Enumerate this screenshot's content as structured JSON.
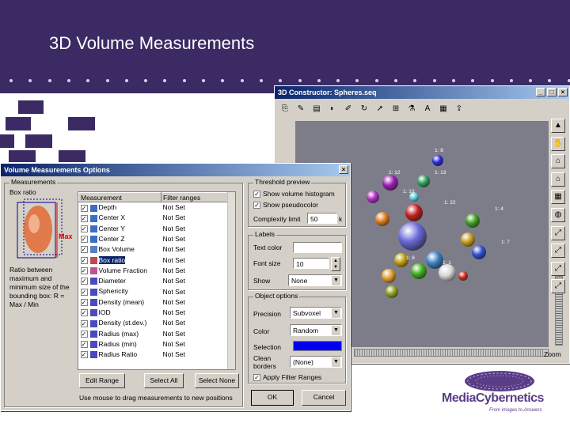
{
  "slide": {
    "title": "3D Volume Measurements"
  },
  "viewer": {
    "title": "3D Constructor: Spheres.seq",
    "zoom_label": "Zoom",
    "toolbar_icons": [
      "copy-icon",
      "wand-icon",
      "document-icon",
      "palette-icon",
      "brush-icon",
      "rotate-icon",
      "arrow-icon",
      "measure-icon",
      "flask-icon",
      "text-icon",
      "table-icon",
      "export-icon"
    ],
    "side_icons": [
      "pointer-icon",
      "hand-icon",
      "home-icon",
      "house-add-icon",
      "grid-icon",
      "sphere-icon",
      "vector-icon",
      "vector-icon",
      "vector-icon",
      "vector-icon"
    ],
    "sphere_labels": [
      "1: 8",
      "1: 12",
      "1: 13",
      "1: 10",
      "1: 22",
      "1: 4",
      "1: 7",
      "1: 6",
      "1: 1"
    ]
  },
  "dialog": {
    "title": "Volume Measurements Options",
    "measurements_group": "Measurements",
    "box_ratio_label": "Box ratio",
    "max_label": "Max",
    "description": "Ratio between maximum and minimum size of the bounding box: R = Max / Min",
    "columns": [
      "Measurement",
      "Filter ranges"
    ],
    "rows": [
      {
        "name": "Depth",
        "filter": "Not Set"
      },
      {
        "name": "Center X",
        "filter": "Not Set"
      },
      {
        "name": "Center Y",
        "filter": "Not Set"
      },
      {
        "name": "Center Z",
        "filter": "Not Set"
      },
      {
        "name": "Box Volume",
        "filter": "Not Set"
      },
      {
        "name": "Box ratio",
        "filter": "Not Set"
      },
      {
        "name": "Volume Fraction",
        "filter": "Not Set"
      },
      {
        "name": "Diameter",
        "filter": "Not Set"
      },
      {
        "name": "Sphericity",
        "filter": "Not Set"
      },
      {
        "name": "Density (mean)",
        "filter": "Not Set"
      },
      {
        "name": "IOD",
        "filter": "Not Set"
      },
      {
        "name": "Density (st.dev.)",
        "filter": "Not Set"
      },
      {
        "name": "Radius (max)",
        "filter": "Not Set"
      },
      {
        "name": "Radius (min)",
        "filter": "Not Set"
      },
      {
        "name": "Radius Ratio",
        "filter": "Not Set"
      }
    ],
    "selected_row": 5,
    "edit_range": "Edit Range",
    "select_all": "Select All",
    "select_none": "Select None",
    "hint": "Use mouse to drag measurements to new positions",
    "threshold_group": "Threshold preview",
    "show_histogram": "Show volume histogram",
    "show_pseudocolor": "Show pseudocolor",
    "complexity_label": "Complexity limit",
    "complexity_value": "50",
    "complexity_unit": "k",
    "labels_group": "Labels",
    "text_color_label": "Text color",
    "font_size_label": "Font size",
    "font_size_value": "10",
    "show_label": "Show",
    "show_value": "None",
    "object_group": "Object options",
    "precision_label": "Precision",
    "precision_value": "Subvoxel",
    "color_label": "Color",
    "color_value": "Random",
    "selection_label": "Selection",
    "selection_color": "#0000ee",
    "clean_borders_label": "Clean borders",
    "clean_borders_value": "(None)",
    "apply_filter": "Apply Filter Ranges",
    "ok": "OK",
    "cancel": "Cancel"
  },
  "brand": {
    "name": "MediaCybernetics",
    "tagline": "From Images to Answers",
    "color": "#5a3d87"
  }
}
